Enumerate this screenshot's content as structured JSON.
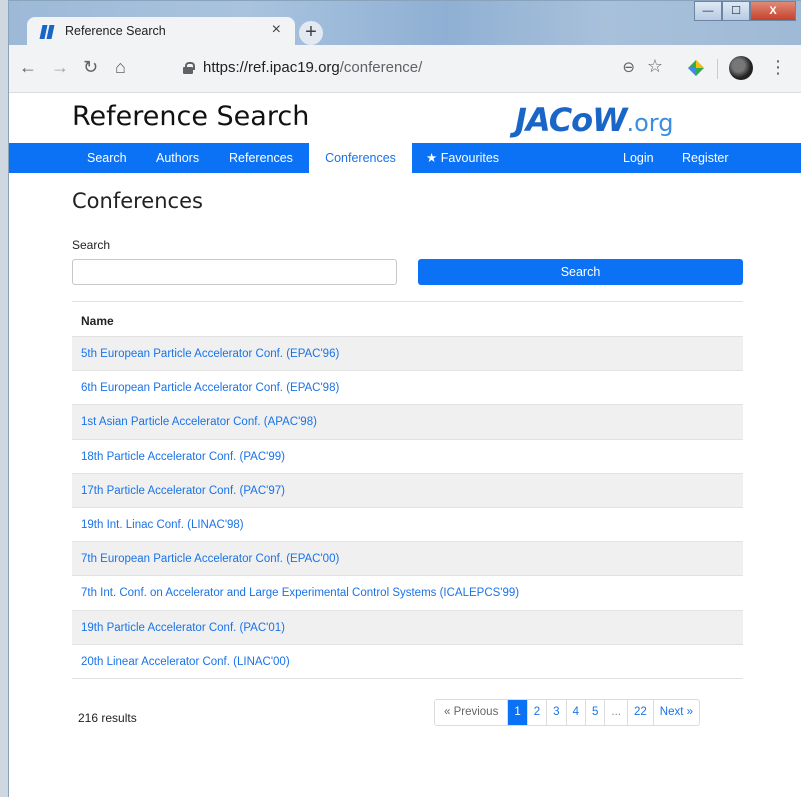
{
  "browser": {
    "tab_title": "Reference Search",
    "tab_close": "×",
    "new_tab": "+",
    "url_host": "https://ref.ipac19.org",
    "url_path": "/conference/",
    "window_controls": {
      "minimize": "—",
      "maximize": "☐",
      "close": "X"
    }
  },
  "site": {
    "title": "Reference Search",
    "logo_main": "JACoW",
    "logo_suffix": ".org"
  },
  "nav": {
    "items": [
      "Search",
      "Authors",
      "References",
      "Conferences",
      "Favourites"
    ],
    "active": "Conferences",
    "favourites_icon": "★",
    "right": [
      "Login",
      "Register"
    ]
  },
  "main": {
    "heading": "Conferences",
    "search_label": "Search",
    "search_value": "",
    "search_button": "Search",
    "table_header": "Name",
    "rows": [
      "5th European Particle Accelerator Conf. (EPAC'96)",
      "6th European Particle Accelerator Conf. (EPAC'98)",
      "1st Asian Particle Accelerator Conf. (APAC'98)",
      "18th Particle Accelerator Conf. (PAC'99)",
      "17th Particle Accelerator Conf. (PAC'97)",
      "19th Int. Linac Conf. (LINAC'98)",
      "7th European Particle Accelerator Conf. (EPAC'00)",
      "7th Int. Conf. on Accelerator and Large Experimental Control Systems (ICALEPCS'99)",
      "19th Particle Accelerator Conf. (PAC'01)",
      "20th Linear Accelerator Conf. (LINAC'00)"
    ],
    "results": "216 results",
    "pagination": [
      "« Previous",
      "1",
      "2",
      "3",
      "4",
      "5",
      "...",
      "22",
      "Next »"
    ],
    "current_page": "1"
  },
  "colors": {
    "brand": "#0b72f5",
    "link": "#1a73e8"
  }
}
